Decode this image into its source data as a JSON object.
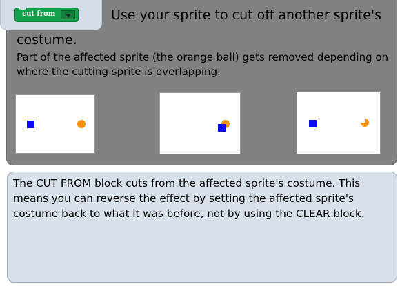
{
  "block": {
    "label": "cut from",
    "dropdown_icon": "chevron-down-icon",
    "color": "#14a14b"
  },
  "header": {
    "title_line1": "Use your sprite to cut off another sprite's",
    "title_line2": "costume.",
    "description": "Part of the affected sprite (the orange ball) gets removed depending on where the cutting sprite is overlapping."
  },
  "stages": [
    {
      "state": "apart",
      "cutter": "blue square",
      "affected": "orange ball"
    },
    {
      "state": "overlapping",
      "cutter": "blue square",
      "affected": "orange ball"
    },
    {
      "state": "cut",
      "cutter": "blue square",
      "affected": "orange ball with a bite removed"
    }
  ],
  "colors": {
    "panel": "#818383",
    "notes_panel": "#d8e1ea",
    "cutter": "#0c0cf5",
    "affected": "#f6900b"
  },
  "notes": {
    "text": "The CUT FROM block cuts from the affected sprite's costume. This means you can reverse the effect by setting the affected sprite's costume back to what it was before, not by using the CLEAR block."
  }
}
